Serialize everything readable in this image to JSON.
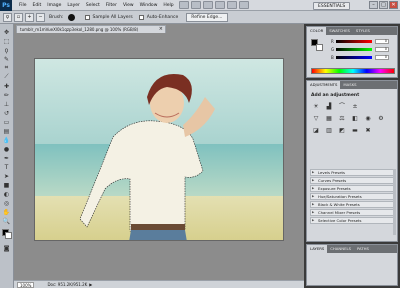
{
  "app": {
    "logo": "Ps",
    "workspace": "ESSENTIALS"
  },
  "menu": [
    "File",
    "Edit",
    "Image",
    "Layer",
    "Select",
    "Filter",
    "View",
    "Window",
    "Help"
  ],
  "window_controls": [
    "–",
    "□",
    "✕"
  ],
  "options": {
    "tool_icon": "lasso-icon",
    "brush_label": "Brush:",
    "brush_size": "",
    "sample_all_layers": "Sample All Layers",
    "auto_enhance": "Auto-Enhance",
    "refine_edge": "Refine Edge..."
  },
  "document": {
    "tab_title": "tumblr_m1mVueXl0k1qzp3ekol_1280.png @ 100% (RGB/8)",
    "tab_close": "×",
    "zoom": "100%",
    "doc_size": "Doc: 951.2K/951.2K"
  },
  "colors": {
    "foreground": "#000000",
    "background": "#ffffff",
    "ui_accent": "#52b2ff"
  },
  "color_panel": {
    "tabs": [
      "COLOR",
      "SWATCHES",
      "STYLES"
    ],
    "channels": [
      {
        "label": "R",
        "value": "0"
      },
      {
        "label": "G",
        "value": "0"
      },
      {
        "label": "B",
        "value": "0"
      }
    ]
  },
  "adjustments_panel": {
    "tabs": [
      "ADJUSTMENTS",
      "MASKS"
    ],
    "header": "Add an adjustment",
    "presets": [
      "Levels Presets",
      "Curves Presets",
      "Exposure Presets",
      "Hue/Saturation Presets",
      "Black & White Presets",
      "Channel Mixer Presets",
      "Selective Color Presets"
    ]
  },
  "layers_panel": {
    "tabs": [
      "LAYERS",
      "CHANNELS",
      "PATHS"
    ]
  }
}
